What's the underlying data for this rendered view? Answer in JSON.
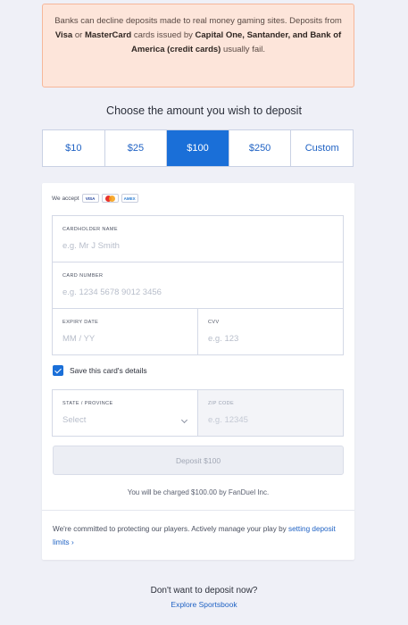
{
  "warning": {
    "p1": "Banks can decline deposits made to real money gaming sites. Deposits from ",
    "visa": "Visa",
    "p2": " or ",
    "mastercard": "MasterCard",
    "p3": " cards issued by ",
    "banks": "Capital One, Santander, and Bank of America (credit cards)",
    "p4": " usually fail."
  },
  "choose_title": "Choose the amount you wish to deposit",
  "amounts": [
    {
      "label": "$10",
      "selected": false
    },
    {
      "label": "$25",
      "selected": false
    },
    {
      "label": "$100",
      "selected": true
    },
    {
      "label": "$250",
      "selected": false
    },
    {
      "label": "Custom",
      "selected": false
    }
  ],
  "form": {
    "we_accept": "We accept",
    "card_icons": [
      "visa-icon",
      "mastercard-icon",
      "amex-icon"
    ],
    "visa_text": "VISA",
    "amex_text": "AMEX",
    "cardholder_label": "CARDHOLDER NAME",
    "cardholder_placeholder": "e.g. Mr J Smith",
    "card_number_label": "CARD NUMBER",
    "card_number_placeholder": "e.g. 1234 5678 9012 3456",
    "expiry_label": "EXPIRY DATE",
    "expiry_placeholder": "MM / YY",
    "cvv_label": "CVV",
    "cvv_placeholder": "e.g. 123",
    "save_label": "Save this card's details",
    "save_checked": true,
    "state_label": "STATE / PROVINCE",
    "state_value": "Select",
    "zip_label": "ZIP CODE",
    "zip_placeholder": "e.g. 12345",
    "deposit_button": "Deposit $100",
    "charged_text": "You will be charged $100.00 by FanDuel Inc.",
    "commit_text": "We're committed to protecting our players. Actively manage your play by ",
    "commit_link": "setting deposit limits",
    "commit_chevron": "›"
  },
  "footer": {
    "question": "Don't want to deposit now?",
    "link": "Explore Sportsbook"
  },
  "colors": {
    "accent": "#1a6fd8",
    "warning_bg": "#fde5da",
    "warning_border": "#f6b79a"
  }
}
